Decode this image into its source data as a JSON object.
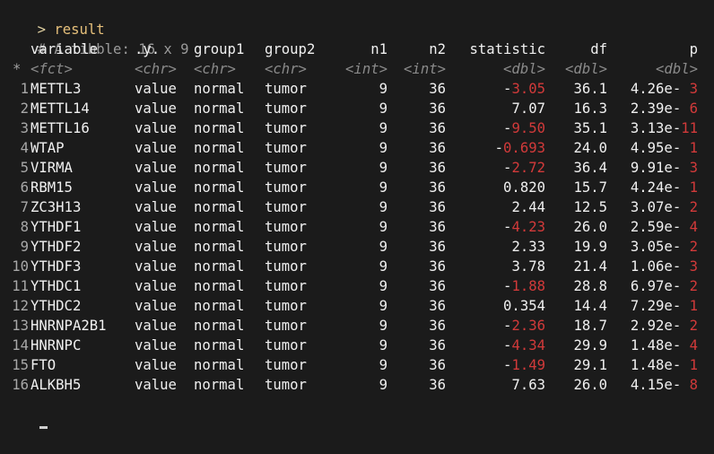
{
  "console": {
    "prompt": ">",
    "command": "result",
    "tibble_note": "# A tibble: 16 x 9",
    "header": {
      "rowid": "",
      "variable": "variable",
      "y": ".y.",
      "group1": "group1",
      "group2": "group2",
      "n1": "n1",
      "n2": "n2",
      "statistic": "statistic",
      "df": "df",
      "p": "p"
    },
    "types": {
      "marker": "*",
      "variable": "<fct>",
      "y": "<chr>",
      "group1": "<chr>",
      "group2": "<chr>",
      "n1": "<int>",
      "n2": "<int>",
      "statistic": "<dbl>",
      "df": "<dbl>",
      "p": "<dbl>"
    },
    "rows": [
      {
        "id": "1",
        "variable": "METTL3",
        "y": "value",
        "group1": "normal",
        "group2": "tumor",
        "n1": "9",
        "n2": "36",
        "stat_sign": "-",
        "stat_val": "3.05",
        "df": "36.1",
        "p_mant": "4.26e-",
        "p_exp": " 3"
      },
      {
        "id": "2",
        "variable": "METTL14",
        "y": "value",
        "group1": "normal",
        "group2": "tumor",
        "n1": "9",
        "n2": "36",
        "stat_sign": "",
        "stat_val": "7.07",
        "df": "16.3",
        "p_mant": "2.39e-",
        "p_exp": " 6"
      },
      {
        "id": "3",
        "variable": "METTL16",
        "y": "value",
        "group1": "normal",
        "group2": "tumor",
        "n1": "9",
        "n2": "36",
        "stat_sign": "-",
        "stat_val": "9.50",
        "df": "35.1",
        "p_mant": "3.13e-",
        "p_exp": "11"
      },
      {
        "id": "4",
        "variable": "WTAP",
        "y": "value",
        "group1": "normal",
        "group2": "tumor",
        "n1": "9",
        "n2": "36",
        "stat_sign": "-",
        "stat_val": "0.693",
        "df": "24.0",
        "p_mant": "4.95e-",
        "p_exp": " 1"
      },
      {
        "id": "5",
        "variable": "VIRMA",
        "y": "value",
        "group1": "normal",
        "group2": "tumor",
        "n1": "9",
        "n2": "36",
        "stat_sign": "-",
        "stat_val": "2.72",
        "df": "36.4",
        "p_mant": "9.91e-",
        "p_exp": " 3"
      },
      {
        "id": "6",
        "variable": "RBM15",
        "y": "value",
        "group1": "normal",
        "group2": "tumor",
        "n1": "9",
        "n2": "36",
        "stat_sign": "",
        "stat_val": "0.820",
        "df": "15.7",
        "p_mant": "4.24e-",
        "p_exp": " 1"
      },
      {
        "id": "7",
        "variable": "ZC3H13",
        "y": "value",
        "group1": "normal",
        "group2": "tumor",
        "n1": "9",
        "n2": "36",
        "stat_sign": "",
        "stat_val": "2.44",
        "df": "12.5",
        "p_mant": "3.07e-",
        "p_exp": " 2"
      },
      {
        "id": "8",
        "variable": "YTHDF1",
        "y": "value",
        "group1": "normal",
        "group2": "tumor",
        "n1": "9",
        "n2": "36",
        "stat_sign": "-",
        "stat_val": "4.23",
        "df": "26.0",
        "p_mant": "2.59e-",
        "p_exp": " 4"
      },
      {
        "id": "9",
        "variable": "YTHDF2",
        "y": "value",
        "group1": "normal",
        "group2": "tumor",
        "n1": "9",
        "n2": "36",
        "stat_sign": "",
        "stat_val": "2.33",
        "df": "19.9",
        "p_mant": "3.05e-",
        "p_exp": " 2"
      },
      {
        "id": "10",
        "variable": "YTHDF3",
        "y": "value",
        "group1": "normal",
        "group2": "tumor",
        "n1": "9",
        "n2": "36",
        "stat_sign": "",
        "stat_val": "3.78",
        "df": "21.4",
        "p_mant": "1.06e-",
        "p_exp": " 3"
      },
      {
        "id": "11",
        "variable": "YTHDC1",
        "y": "value",
        "group1": "normal",
        "group2": "tumor",
        "n1": "9",
        "n2": "36",
        "stat_sign": "-",
        "stat_val": "1.88",
        "df": "28.8",
        "p_mant": "6.97e-",
        "p_exp": " 2"
      },
      {
        "id": "12",
        "variable": "YTHDC2",
        "y": "value",
        "group1": "normal",
        "group2": "tumor",
        "n1": "9",
        "n2": "36",
        "stat_sign": "",
        "stat_val": "0.354",
        "df": "14.4",
        "p_mant": "7.29e-",
        "p_exp": " 1"
      },
      {
        "id": "13",
        "variable": "HNRNPA2B1",
        "y": "value",
        "group1": "normal",
        "group2": "tumor",
        "n1": "9",
        "n2": "36",
        "stat_sign": "-",
        "stat_val": "2.36",
        "df": "18.7",
        "p_mant": "2.92e-",
        "p_exp": " 2"
      },
      {
        "id": "14",
        "variable": "HNRNPC",
        "y": "value",
        "group1": "normal",
        "group2": "tumor",
        "n1": "9",
        "n2": "36",
        "stat_sign": "-",
        "stat_val": "4.34",
        "df": "29.9",
        "p_mant": "1.48e-",
        "p_exp": " 4"
      },
      {
        "id": "15",
        "variable": "FTO",
        "y": "value",
        "group1": "normal",
        "group2": "tumor",
        "n1": "9",
        "n2": "36",
        "stat_sign": "-",
        "stat_val": "1.49",
        "df": "29.1",
        "p_mant": "1.48e-",
        "p_exp": " 1"
      },
      {
        "id": "16",
        "variable": "ALKBH5",
        "y": "value",
        "group1": "normal",
        "group2": "tumor",
        "n1": "9",
        "n2": "36",
        "stat_sign": "",
        "stat_val": "7.63",
        "df": "26.0",
        "p_mant": "4.15e-",
        "p_exp": " 8"
      }
    ],
    "colors": {
      "background": "#1b1b1b",
      "text": "#f0f0f0",
      "command": "#e6c07b",
      "comment": "#9a9a9a",
      "negative": "#d23a3a",
      "type": "#8a8a8a"
    }
  }
}
